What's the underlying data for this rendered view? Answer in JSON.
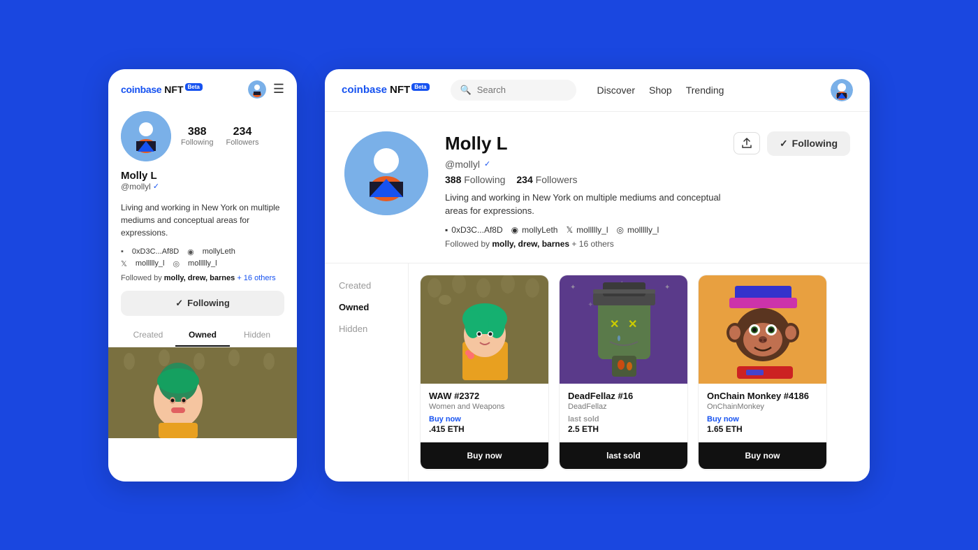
{
  "brand": {
    "logo_coinbase": "coinbase",
    "logo_nft": "NFT",
    "beta": "Beta"
  },
  "nav": {
    "search_placeholder": "Search",
    "links": [
      "Discover",
      "Shop",
      "Trending"
    ]
  },
  "user": {
    "name": "Molly L",
    "handle": "@mollyl",
    "verified": true,
    "following_count": "388",
    "followers_count": "234",
    "following_label": "Following",
    "followers_label": "Followers",
    "bio": "Living and working in New York on multiple mediums and conceptual areas for expressions.",
    "wallet": "0xD3C...Af8D",
    "ens": "mollyLeth",
    "twitter": "mollllly_l",
    "instagram": "mollllly_l",
    "followed_by": "molly, drew, barnes",
    "followed_by_others": "+ 16 others"
  },
  "buttons": {
    "following": "Following",
    "share": "↑"
  },
  "tabs": {
    "created": "Created",
    "owned": "Owned",
    "hidden": "Hidden"
  },
  "nfts": [
    {
      "title": "WAW #2372",
      "collection": "Women and Weapons",
      "price_label": "Buy now",
      "price": ".415 ETH",
      "action": "Buy now",
      "bg": "#b5aa5e",
      "type": "waw"
    },
    {
      "title": "DeadFellaz #16",
      "collection": "DeadFellaz",
      "price_label": "last sold",
      "price": "2.5 ETH",
      "action": "last sold",
      "bg": "#6b4fa0",
      "type": "deadfellaz"
    },
    {
      "title": "OnChain Monkey #4186",
      "collection": "OnChainMonkey",
      "price_label": "Buy now",
      "price": "1.65 ETH",
      "action": "Buy now",
      "bg": "#e8a040",
      "type": "monkey"
    }
  ]
}
